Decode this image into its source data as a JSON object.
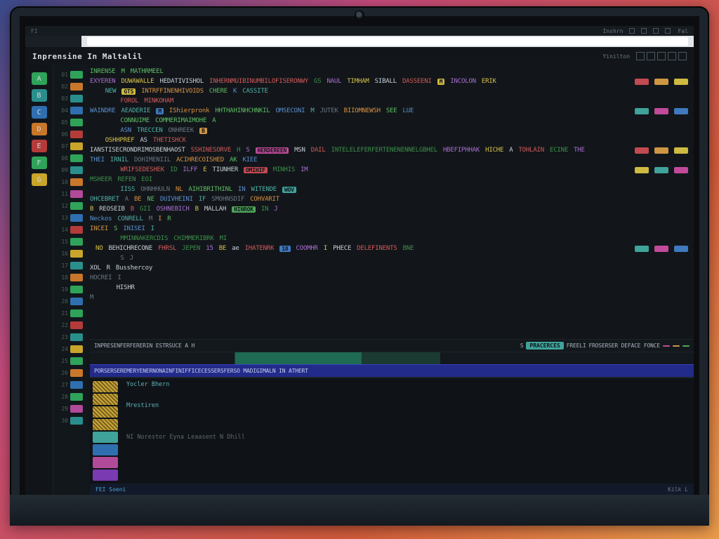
{
  "menubar": {
    "left": "FI",
    "right_text": "Inshrn",
    "right_label": "Fal"
  },
  "titlebar": {
    "title": "Inprensine In Maltalil",
    "hint": "Yinilton"
  },
  "sidebar_labels": [
    "A",
    "B",
    "C",
    "D",
    "E",
    "F",
    "G"
  ],
  "sidebar2_numbers": [
    "01",
    "02",
    "03",
    "04",
    "05",
    "06",
    "07",
    "08",
    "09",
    "10",
    "11",
    "12",
    "13",
    "14",
    "15",
    "16",
    "17",
    "18",
    "19",
    "20",
    "21",
    "22",
    "23",
    "24",
    "25",
    "26",
    "27",
    "28",
    "29",
    "30"
  ],
  "strip1": {
    "label": "INPRESENFERFERERIN ESTRSUCE A H",
    "cells": [
      "S",
      "PRACERCES",
      "FREELI",
      "FROSERSER DEFACE FONCE",
      "  "
    ]
  },
  "strip2": {
    "label": "PORSERSEREMERYENERNONAINFINIFFICECESSERSFERSO MADIGIMALN IN  ATHERT"
  },
  "panel": {
    "line1": "Yocler Bhern",
    "line2": "Mrestiren",
    "line3": "NI Norestor    Eyna Leaasent  N Dhill"
  },
  "footer": {
    "left": "FEI Soeni",
    "right": "Kilk L"
  }
}
